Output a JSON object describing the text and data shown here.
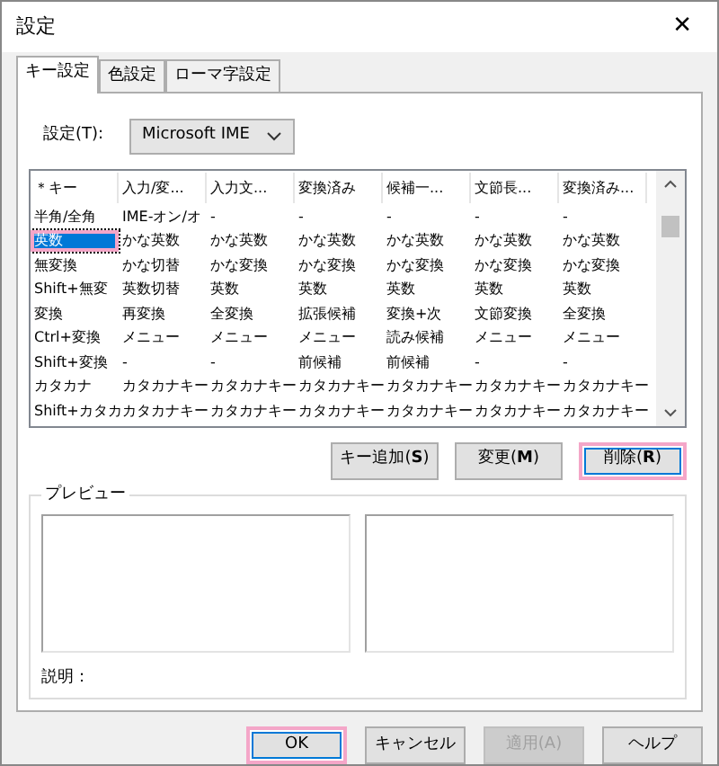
{
  "window": {
    "title": "設定",
    "close": "✕"
  },
  "tabs": [
    {
      "label": "キー設定",
      "selected": true
    },
    {
      "label": "色設定",
      "selected": false
    },
    {
      "label": "ローマ字設定",
      "selected": false
    }
  ],
  "setting": {
    "label": "設定(T):",
    "value": "Microsoft IME"
  },
  "table": {
    "columns": [
      "＊キー",
      "入力/変...",
      "入力文...",
      "変換済み",
      "候補一...",
      "文節長...",
      "変換済み..."
    ],
    "rows": [
      {
        "cells": [
          "半角/全角",
          "IME-オン/オ",
          "-",
          "-",
          "-",
          "-",
          "-"
        ],
        "selected": false,
        "highlighted": false
      },
      {
        "cells": [
          "英数",
          "かな英数",
          "かな英数",
          "かな英数",
          "かな英数",
          "かな英数",
          "かな英数"
        ],
        "selected": true,
        "highlighted": true
      },
      {
        "cells": [
          "無変換",
          "かな切替",
          "かな変換",
          "かな変換",
          "かな変換",
          "かな変換",
          "かな変換"
        ],
        "selected": false,
        "highlighted": false
      },
      {
        "cells": [
          "Shift+無変",
          "英数切替",
          "英数",
          "英数",
          "英数",
          "英数",
          "英数"
        ],
        "selected": false,
        "highlighted": false
      },
      {
        "cells": [
          "変換",
          "再変換",
          "全変換",
          "拡張候補",
          "変換+次",
          "文節変換",
          "全変換"
        ],
        "selected": false,
        "highlighted": false
      },
      {
        "cells": [
          "Ctrl+変換",
          "メニュー",
          "メニュー",
          "メニュー",
          "読み候補",
          "メニュー",
          "メニュー"
        ],
        "selected": false,
        "highlighted": false
      },
      {
        "cells": [
          "Shift+変換",
          "-",
          "-",
          "前候補",
          "前候補",
          "-",
          "-"
        ],
        "selected": false,
        "highlighted": false
      },
      {
        "cells": [
          "カタカナ",
          "カタカナキー",
          "カタカナキー",
          "カタカナキー",
          "カタカナキー",
          "カタカナキー",
          "カタカナキー"
        ],
        "selected": false,
        "highlighted": false
      },
      {
        "cells": [
          "Shift+カタカ",
          "カタカナキー",
          "カタカナキー",
          "カタカナキー",
          "カタカナキー",
          "カタカナキー",
          "カタカナキー"
        ],
        "selected": false,
        "highlighted": false
      }
    ]
  },
  "key_buttons": [
    {
      "label": "キー追加(**S**)",
      "highlighted": false
    },
    {
      "label": "変更(**M**)",
      "highlighted": false
    },
    {
      "label": "削除(**R**)",
      "highlighted": true
    }
  ],
  "preview": {
    "title": "プレビュー",
    "description_label": "説明："
  },
  "dialog_buttons": [
    {
      "label": "OK",
      "disabled": false,
      "highlighted": true
    },
    {
      "label": "キャンセル",
      "disabled": false,
      "highlighted": false
    },
    {
      "label": "適用(A)",
      "disabled": true,
      "highlighted": false
    },
    {
      "label": "ヘルプ",
      "disabled": false,
      "highlighted": false
    }
  ]
}
